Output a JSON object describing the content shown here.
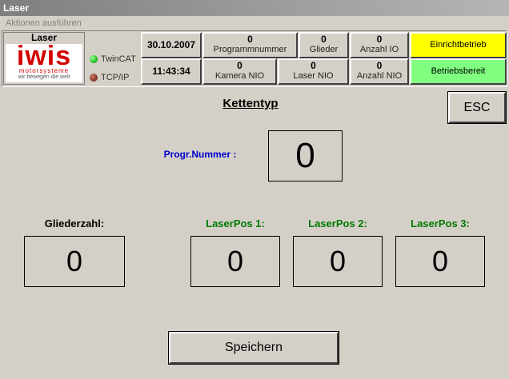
{
  "window": {
    "title": "Laser"
  },
  "menu": {
    "actions": "Aktionen ausführen"
  },
  "header": {
    "station": "Laser",
    "logo": {
      "brand": "iwis",
      "sub": "motorsysteme",
      "tagline": "wir bewegen die welt"
    },
    "status": {
      "twincat": "TwinCAT",
      "tcpip": "TCP/IP"
    },
    "date": "30.10.2007",
    "time": "11:43:34",
    "counters": {
      "programmnummer": {
        "value": "0",
        "label": "Programmnummer"
      },
      "glieder": {
        "value": "0",
        "label": "Glieder"
      },
      "anzahl_io": {
        "value": "0",
        "label": "Anzahl IO"
      },
      "kamera_nio": {
        "value": "0",
        "label": "Kamera NIO"
      },
      "laser_nio": {
        "value": "0",
        "label": "Laser NIO"
      },
      "anzahl_nio": {
        "value": "0",
        "label": "Anzahl NIO"
      }
    },
    "mode": {
      "einricht": "Einrichtbetrieb",
      "betriebsbereit": "Betriebsbereit"
    }
  },
  "main": {
    "title": "Kettentyp",
    "esc": "ESC",
    "progr_label": "Progr.Nummer :",
    "progr_value": "0",
    "gliederzahl_label": "Gliederzahl:",
    "gliederzahl_value": "0",
    "laserpos1_label": "LaserPos 1:",
    "laserpos1_value": "0",
    "laserpos2_label": "LaserPos 2:",
    "laserpos2_value": "0",
    "laserpos3_label": "LaserPos 3:",
    "laserpos3_value": "0",
    "save": "Speichern"
  },
  "colors": {
    "einricht_bg": "#ffff00",
    "betriebsbereit_bg": "#80ff80",
    "progr_label": "#0000cc",
    "laserpos_label": "#007a00",
    "led_twincat": "#22c022",
    "led_tcpip": "#8a3a2a"
  }
}
